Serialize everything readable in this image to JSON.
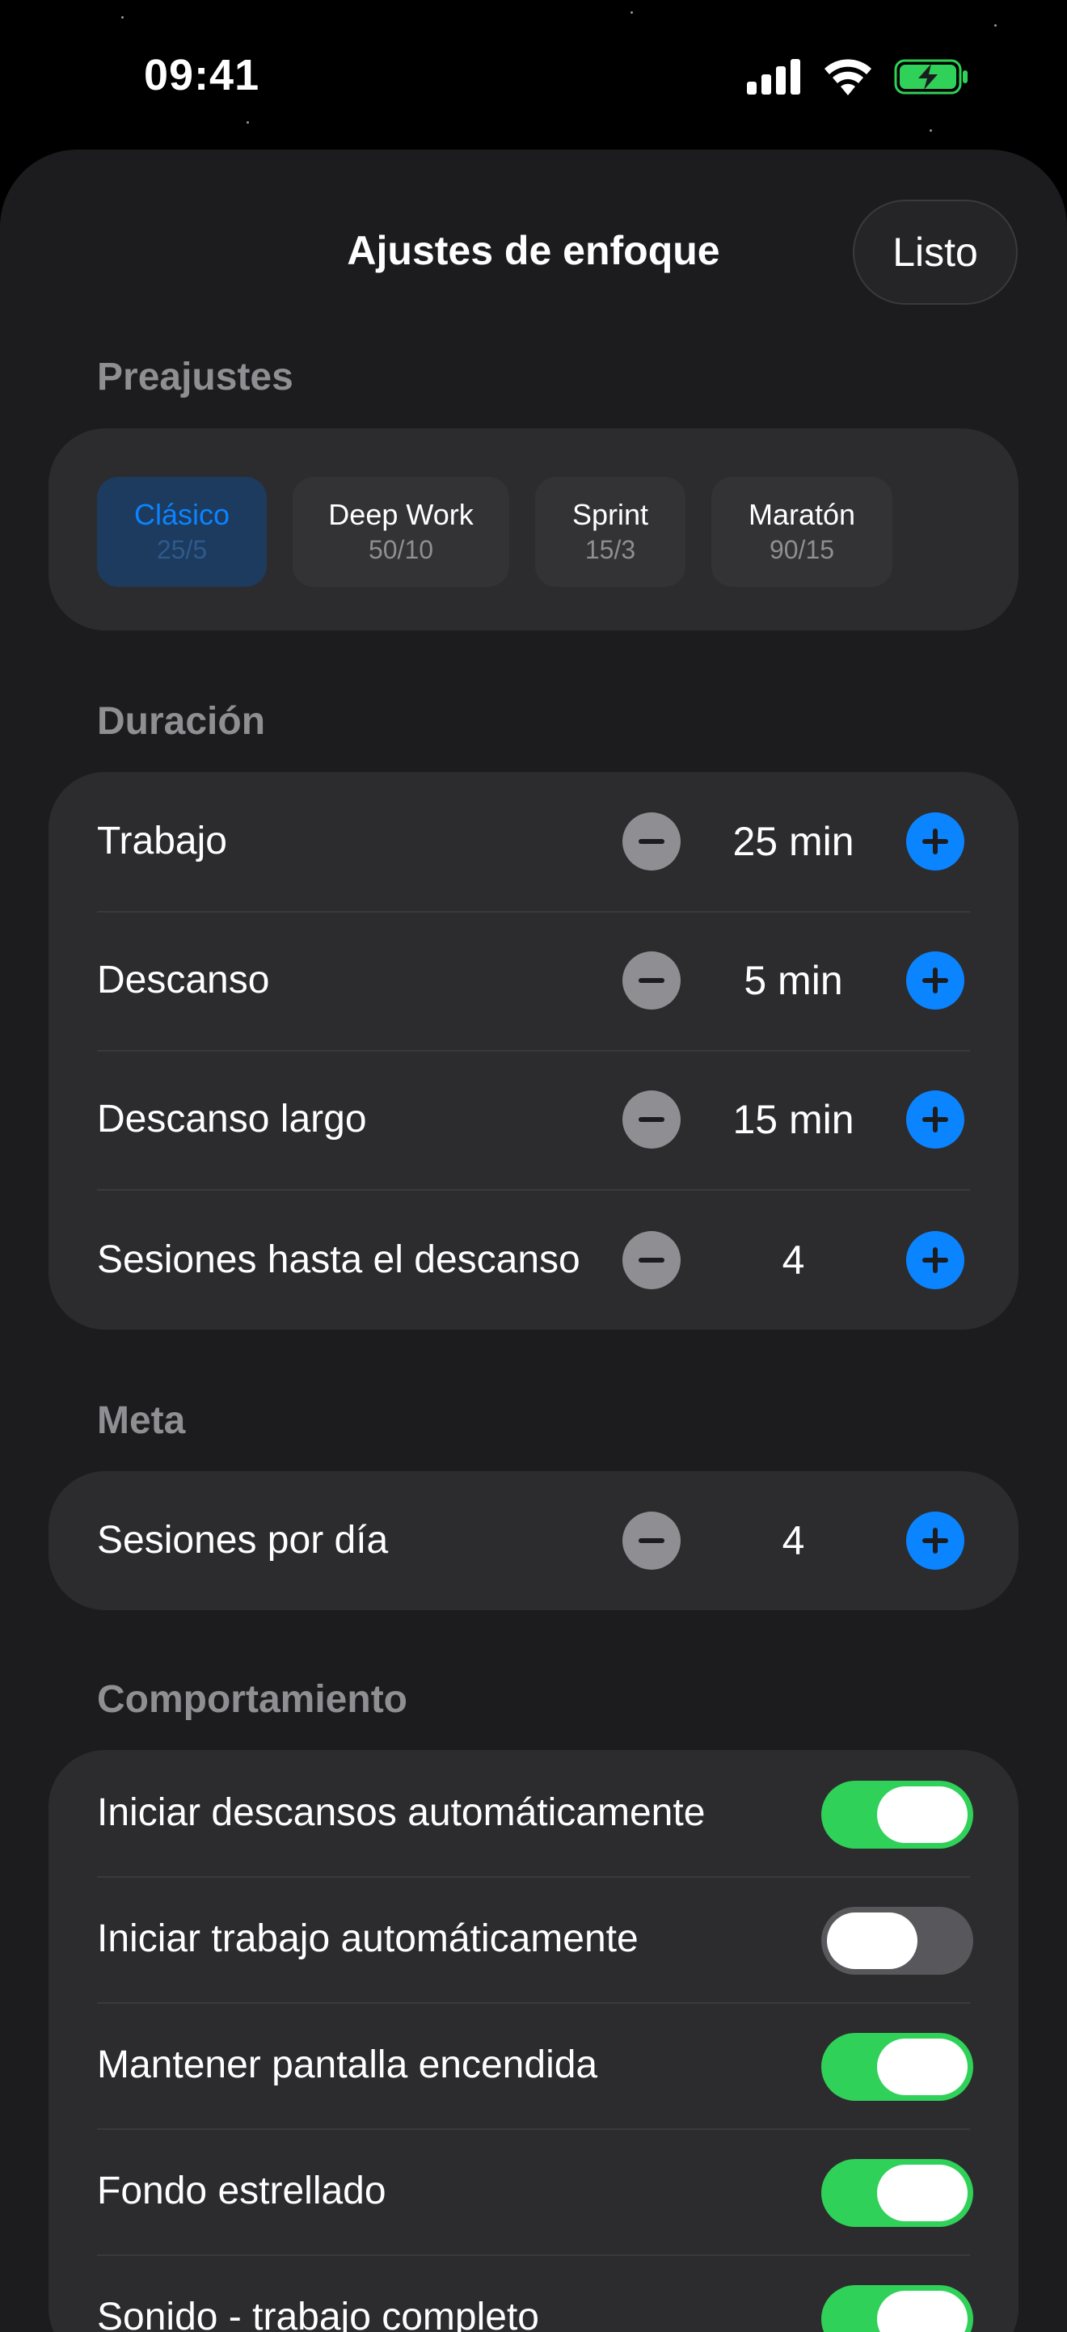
{
  "status_bar": {
    "time": "09:41",
    "icons": [
      "cellular-signal-icon",
      "wifi-icon",
      "battery-charging-icon"
    ],
    "battery_color": "#30d158"
  },
  "header": {
    "title": "Ajustes de enfoque",
    "done_label": "Listo"
  },
  "presets": {
    "section_title": "Preajustes",
    "selected_index": 0,
    "items": [
      {
        "name": "Clásico",
        "value": "25/5"
      },
      {
        "name": "Deep Work",
        "value": "50/10"
      },
      {
        "name": "Sprint",
        "value": "15/3"
      },
      {
        "name": "Maratón",
        "value": "90/15"
      }
    ]
  },
  "duration": {
    "section_title": "Duración",
    "rows": [
      {
        "label": "Trabajo",
        "value": "25 min"
      },
      {
        "label": "Descanso",
        "value": "5 min"
      },
      {
        "label": "Descanso largo",
        "value": "15 min"
      },
      {
        "label": "Sesiones hasta el descanso",
        "value": "4"
      }
    ]
  },
  "goal": {
    "section_title": "Meta",
    "rows": [
      {
        "label": "Sesiones por día",
        "value": "4"
      }
    ]
  },
  "behavior": {
    "section_title": "Comportamiento",
    "rows": [
      {
        "label": "Iniciar descansos automáticamente",
        "on": true
      },
      {
        "label": "Iniciar trabajo automáticamente",
        "on": false
      },
      {
        "label": "Mantener pantalla encendida",
        "on": true
      },
      {
        "label": "Fondo estrellado",
        "on": true
      },
      {
        "label": "Sonido - trabajo completo",
        "on": true
      }
    ]
  },
  "colors": {
    "accent": "#0a84ff",
    "toggle_on": "#30d158",
    "toggle_off": "#58585c",
    "card_bg": "#2c2c2e",
    "sheet_bg": "#1c1c1e"
  }
}
